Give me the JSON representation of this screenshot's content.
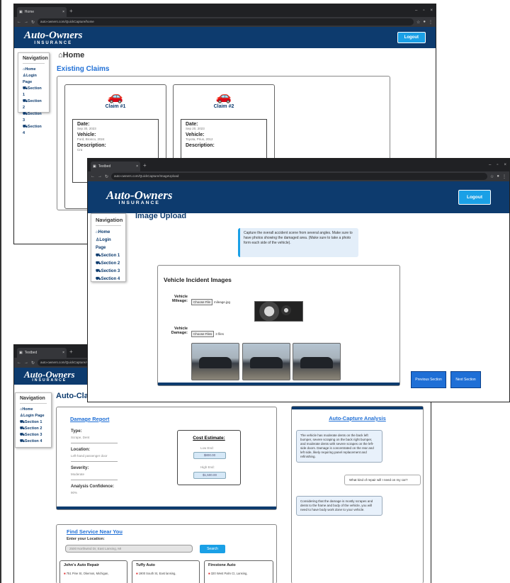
{
  "win1": {
    "tab_title": "Home",
    "url": "auto-owners.com/QuickCapture/home",
    "logo": "Auto-Owners",
    "logo_sub": "INSURANCE",
    "logout": "Logout",
    "nav_title": "Navigation",
    "nav_items": [
      "Home",
      "Login Page",
      "Section 1",
      "Section 2",
      "Section 3",
      "Section 4"
    ],
    "page_title": "Home",
    "section_title": "Existing Claims",
    "claims": [
      {
        "title": "Claim #1",
        "date_label": "Date:",
        "date": "Sep 30, 2023",
        "vehicle_label": "Vehicle:",
        "vehicle": "Ford, Bronco, 2024",
        "desc_label": "Description:",
        "desc": "Cra"
      },
      {
        "title": "Claim #2",
        "date_label": "Date:",
        "date": "Sep 20, 2023",
        "vehicle_label": "Vehicle:",
        "vehicle": "Toyota, Prius, 2012",
        "desc_label": "Description:",
        "desc": ""
      }
    ]
  },
  "win2": {
    "tab_title": "Testbed",
    "url": "auto-owners.com/QuickCapture/ImageUpload",
    "logo": "Auto-Owners",
    "logo_sub": "INSURANCE",
    "logout": "Logout",
    "nav_title": "Navigation",
    "nav_items": [
      "Home",
      "Login Page",
      "Section 1",
      "Section 2",
      "Section 3",
      "Section 4"
    ],
    "page_title": "Image Upload",
    "instructions": "Capture the overall accident scene from several angles. Make sure to have photos showing the damaged area. (Make sure to take a photo form each side of the vehicle).",
    "card_title": "Vehicle Incident Images",
    "mileage_label": "Vehicle Mileage:",
    "mileage_btn": "Choose File",
    "mileage_file": "mileage.jpg",
    "damage_label": "Vehicle Damage:",
    "damage_btn": "Choose Files",
    "damage_files": "3 files",
    "prev": "Previous Section",
    "next": "Next Section"
  },
  "win3": {
    "tab_title": "Testbed",
    "url": "auto-owners.com/QuickCapture/Auto",
    "logo": "Auto-Owners",
    "logo_sub": "INSURANCE",
    "nav_title": "Navigation",
    "nav_items": [
      "Home",
      "Login Page",
      "Section 1",
      "Section 2",
      "Section 3",
      "Section 4"
    ],
    "page_title": "Auto-Clai",
    "report_title": "Damage Report",
    "type_label": "Type:",
    "type": "Scrape, Dent",
    "location_label": "Location:",
    "location": "Left-hand passenger door",
    "severity_label": "Severity:",
    "severity": "Moderate",
    "confidence_label": "Analysis Confidence:",
    "confidence": "90%",
    "cost_title": "Cost Estimate:",
    "low_label": "Low End:",
    "low": "$800.00",
    "high_label": "High End:",
    "high": "$1,500.00",
    "analysis_title": "Auto-Capture Analysis",
    "msg1": "The vehicle has moderate dents on the back left bumper, severe scraping on the back right bumper, and moderate dents with severe scrapes on the left-side doors. Damage is concentrated on the rear and left side, likely requiring panel replacement and refinishing.",
    "user_msg": "What kind of repair will I need on my car?",
    "msg2": "Considering that the damage is mostly scrapes and dents to the frame and body of the vehicle, you will need to have body work done to your vehicle.",
    "service_title": "Find Service Near You",
    "location_prompt": "Enter your Location:",
    "location_value": "2500 Northwind Dr, East Lansing, MI",
    "search": "Search",
    "shops": [
      {
        "name": "John's Auto Repair",
        "addr": "751 Pine St, Okemos, Michigan,"
      },
      {
        "name": "Tuffy Auto",
        "addr": "1900 South St, East lansing,"
      },
      {
        "name": "Firestone Auto",
        "addr": "320 West Palm Ct, Lansing,"
      }
    ]
  },
  "icons": {
    "home": "home-icon",
    "person": "person-icon",
    "car": "car-icon"
  },
  "colors": {
    "brand": "#0d3b6e",
    "accent": "#1aa0e6",
    "button": "#1f6fd6"
  }
}
